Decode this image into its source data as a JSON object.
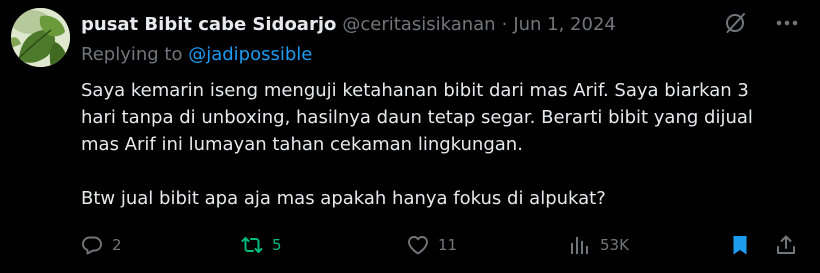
{
  "tweet": {
    "display_name": "pusat Bibit cabe Sidoarjo",
    "handle": "@ceritasisikanan",
    "separator": "·",
    "date": "Jun 1, 2024",
    "replying_prefix": "Replying to",
    "replying_to": "@jadipossible",
    "body_line_1": "Saya kemarin iseng menguji ketahanan bibit dari mas Arif. Saya biarkan 3",
    "body_line_2": "hari tanpa di unboxing, hasilnya daun tetap segar. Berarti bibit yang dijual",
    "body_line_3": "mas Arif ini lumayan tahan cekaman lingkungan.",
    "body_line_4": "Btw jual bibit apa aja mas apakah hanya fokus di alpukat?"
  },
  "header_icons": [
    "grok-icon",
    "more-icon"
  ],
  "actions": {
    "replies": "2",
    "reposts": "5",
    "likes": "11",
    "views": "53K"
  },
  "colors": {
    "background": "#000000",
    "text": "#e7e9ea",
    "muted": "#71767b",
    "link": "#1d9bf0",
    "repost_active": "#00ba7c",
    "bookmark_active": "#1d9bf0"
  },
  "icons": {
    "reply": "reply-icon",
    "repost": "repost-icon",
    "like": "heart-icon",
    "views": "views-icon",
    "bookmark": "bookmark-icon",
    "share": "share-icon"
  }
}
